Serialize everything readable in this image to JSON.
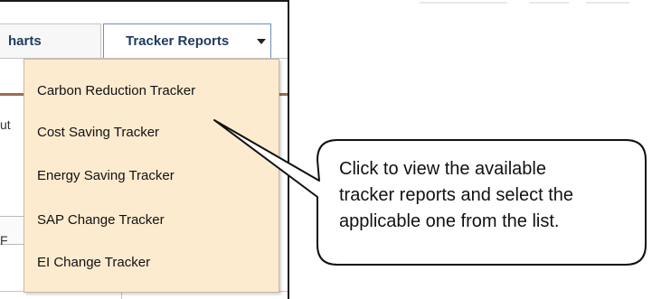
{
  "tabs": [
    {
      "label": "harts"
    },
    {
      "label": "Tracker Reports"
    }
  ],
  "background_fragments": {
    "a": "ut",
    "b": "F"
  },
  "dropdown": {
    "items": [
      {
        "label": "Carbon Reduction Tracker"
      },
      {
        "label": "Cost Saving Tracker"
      },
      {
        "label": "Energy Saving Tracker"
      },
      {
        "label": "SAP Change Tracker"
      },
      {
        "label": "EI Change Tracker"
      }
    ]
  },
  "callout": {
    "lines": [
      "Click to view the available",
      "tracker reports and select the",
      "applicable one from the list."
    ]
  },
  "colors": {
    "dropdown_bg": "#fdebd0",
    "tab_text": "#1f3a5f",
    "divider_accent": "#9e6b4f"
  },
  "icons": {
    "tab_dropdown": "caret-down-icon"
  }
}
